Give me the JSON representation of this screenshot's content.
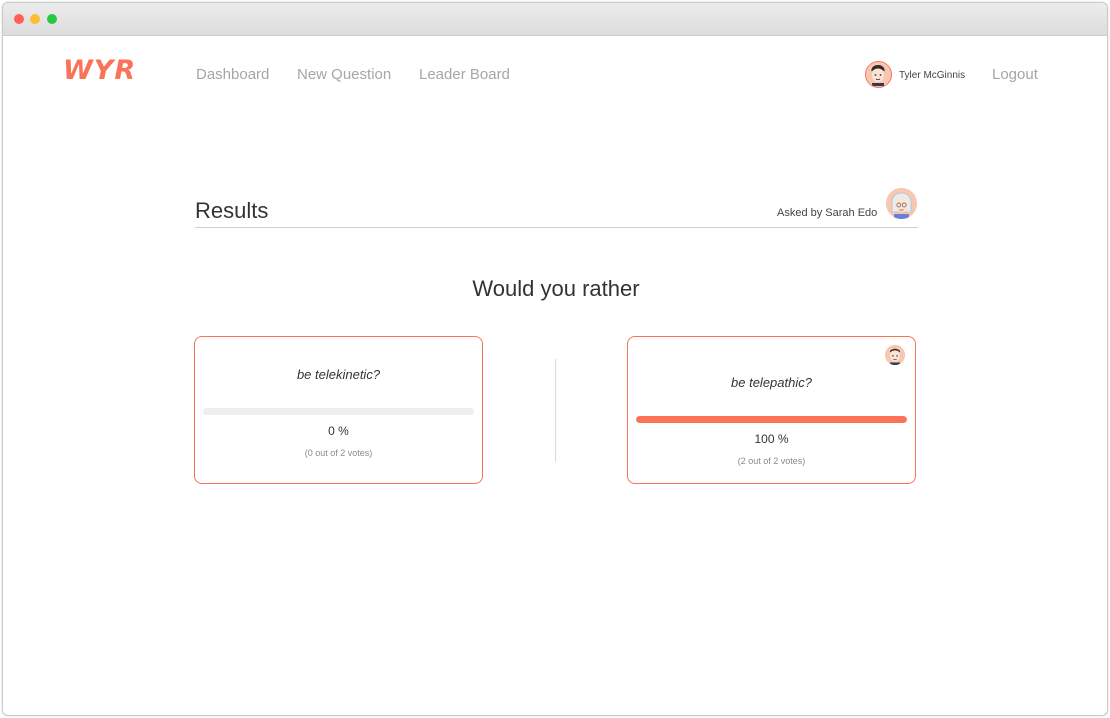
{
  "app": {
    "logo": "WYR",
    "accent_color": "#f87358"
  },
  "nav": {
    "links": [
      "Dashboard",
      "New Question",
      "Leader Board"
    ],
    "user_name": "Tyler McGinnis",
    "logout": "Logout"
  },
  "results": {
    "title": "Results",
    "asked_by": "Asked by Sarah Edo",
    "question": "Would you rather",
    "options": [
      {
        "text": "be telekinetic?",
        "percent_label": "0 %",
        "votes_label": "(0 out of 2 votes)",
        "fraction": 0,
        "user_voted": false
      },
      {
        "text": "be telepathic?",
        "percent_label": "100 %",
        "votes_label": "(2 out of 2 votes)",
        "fraction": 1,
        "user_voted": true
      }
    ]
  }
}
